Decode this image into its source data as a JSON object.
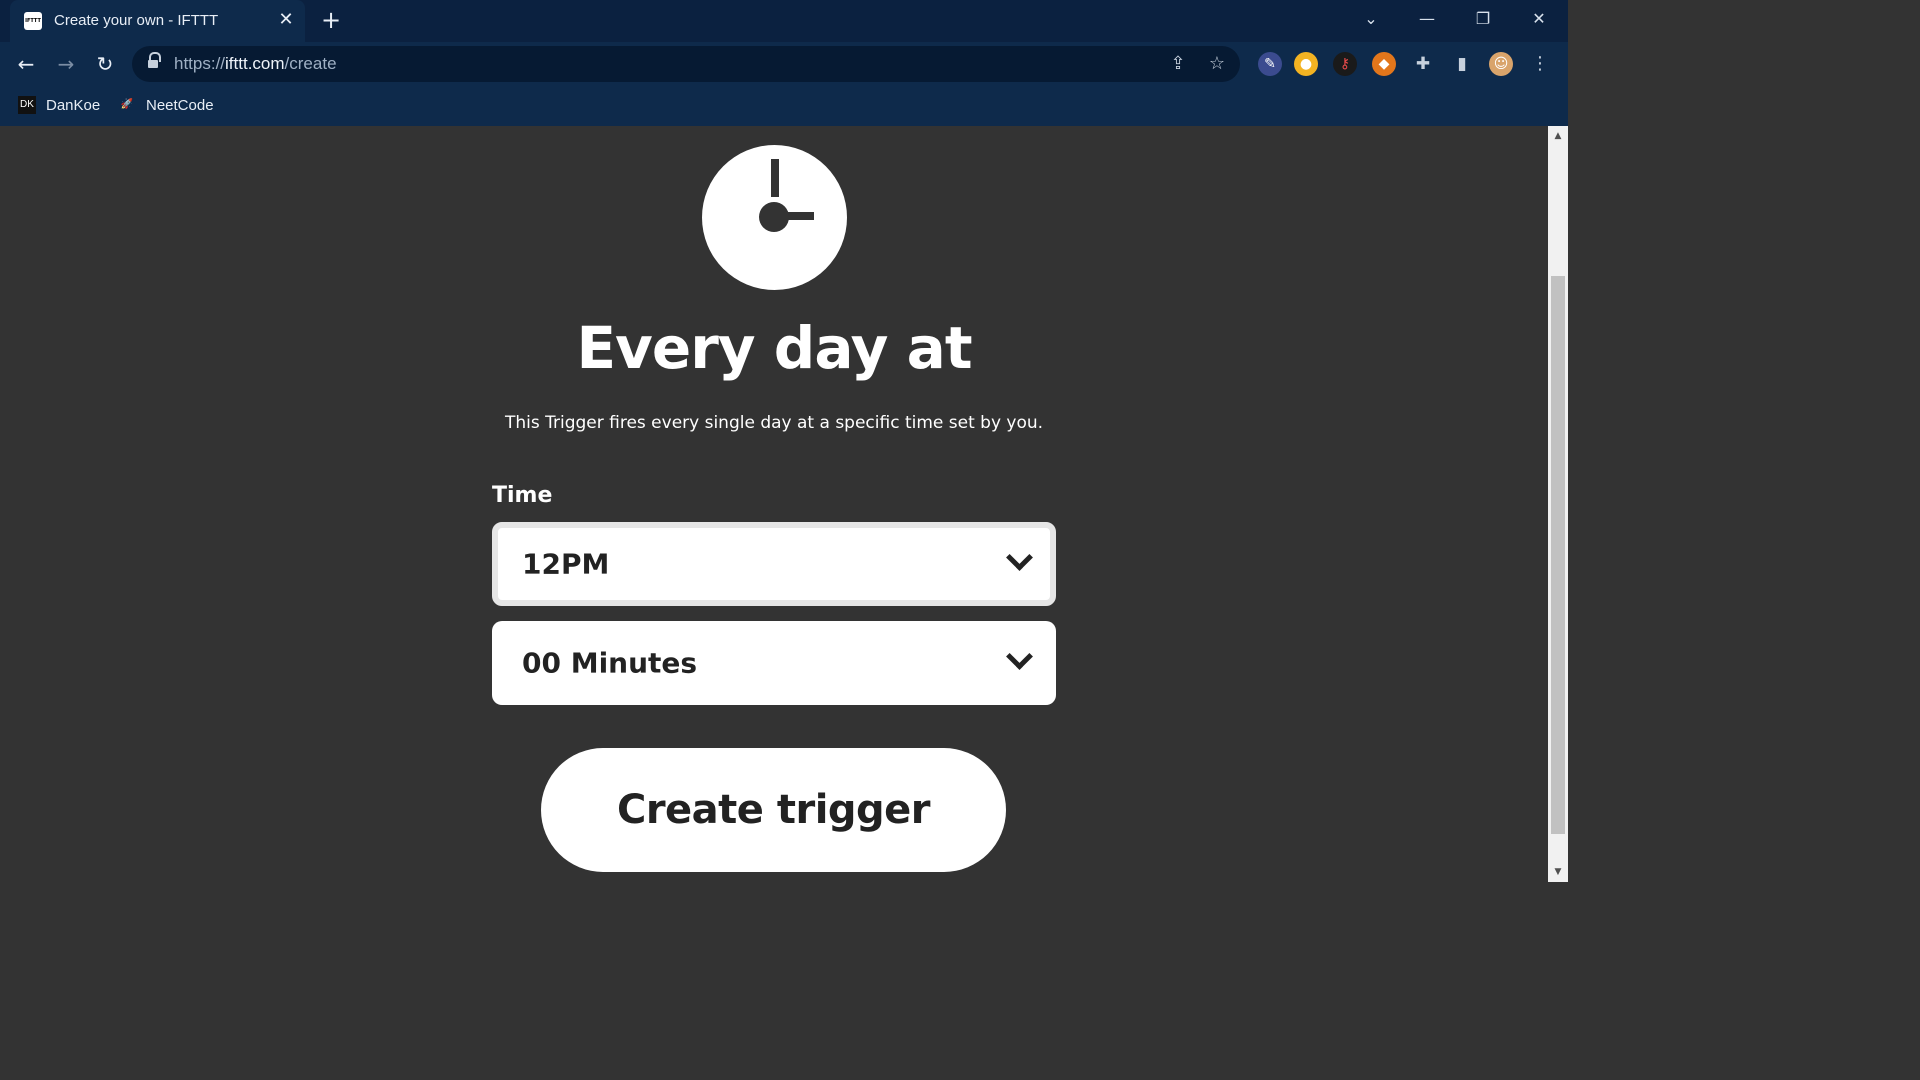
{
  "browser": {
    "tab_title": "Create your own - IFTTT",
    "tab_favicon_text": "IFTTT",
    "url_prefix": "https://",
    "url_host": "ifttt.com",
    "url_path": "/create",
    "bookmarks": [
      {
        "label": "DanKoe",
        "icon": "dankoe-logo-icon"
      },
      {
        "label": "NeetCode",
        "icon": "neetcode-rocket-icon"
      }
    ]
  },
  "page": {
    "icon": "clock-icon",
    "heading": "Every day at",
    "description": "This Trigger fires every single day at a specific time set by you.",
    "time_label": "Time",
    "hour_select_value": "12PM",
    "minute_select_value": "00 Minutes",
    "create_button_label": "Create trigger"
  },
  "colors": {
    "page_background": "#333333",
    "chrome_background": "#0e2a4b",
    "button_background": "#ffffff",
    "text_dark": "#222222"
  }
}
